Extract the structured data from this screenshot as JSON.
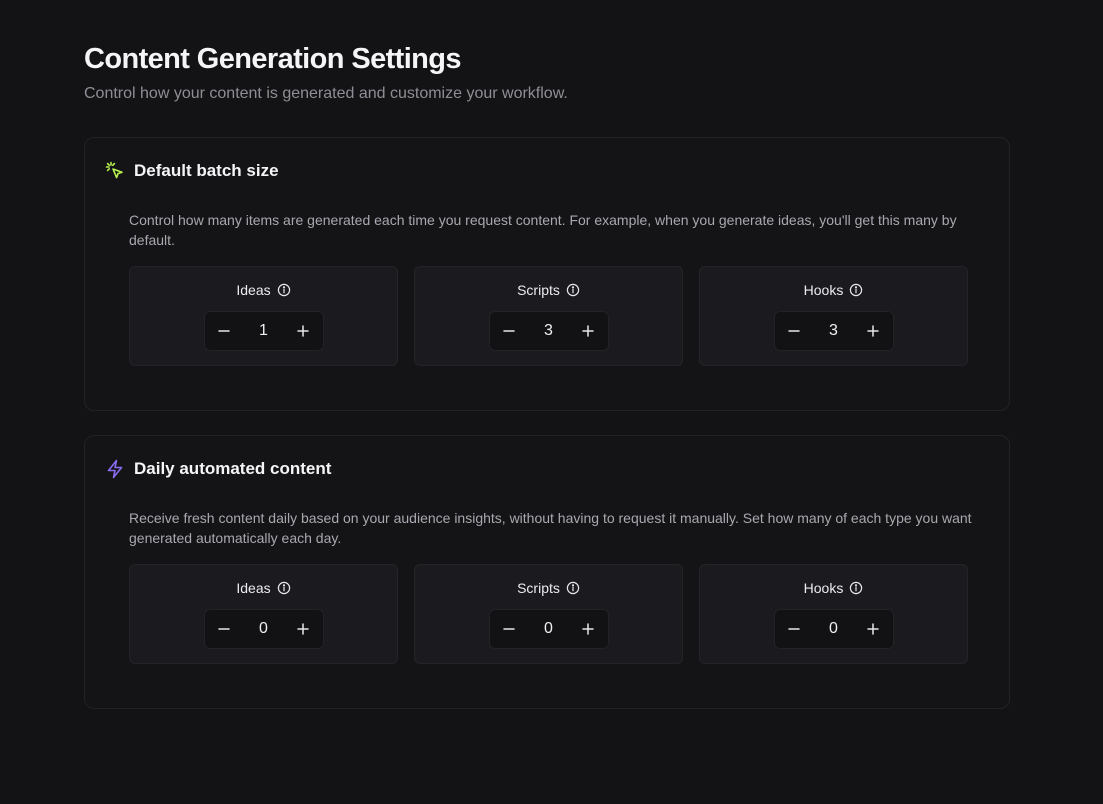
{
  "header": {
    "title": "Content Generation Settings",
    "subtitle": "Control how your content is generated and customize your workflow."
  },
  "colors": {
    "background": "#131315",
    "batch_icon": "#b8f34f",
    "automated_icon": "#8a6cf0"
  },
  "sections": [
    {
      "title": "Default batch size",
      "icon": "cursor-click-icon",
      "description": "Control how many items are generated each time you request content. For example, when you generate ideas, you'll get this many by default.",
      "counters": [
        {
          "label": "Ideas",
          "value": "1"
        },
        {
          "label": "Scripts",
          "value": "3"
        },
        {
          "label": "Hooks",
          "value": "3"
        }
      ]
    },
    {
      "title": "Daily automated content",
      "icon": "lightning-bolt-icon",
      "description": "Receive fresh content daily based on your audience insights, without having to request it manually. Set how many of each type you want generated automatically each day.",
      "counters": [
        {
          "label": "Ideas",
          "value": "0"
        },
        {
          "label": "Scripts",
          "value": "0"
        },
        {
          "label": "Hooks",
          "value": "0"
        }
      ]
    }
  ]
}
